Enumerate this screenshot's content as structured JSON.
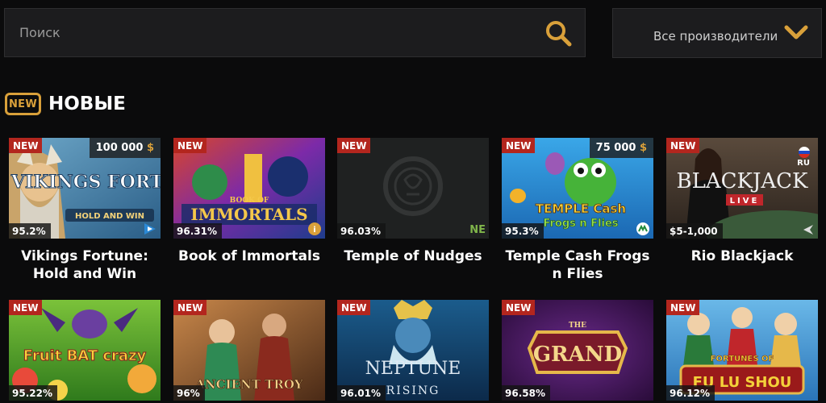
{
  "search": {
    "placeholder": "Поиск"
  },
  "provider_filter": {
    "selected": "Все производители"
  },
  "section": {
    "badge": "NEW",
    "title": "НОВЫЕ"
  },
  "colors": {
    "accent": "#d9a03a",
    "badge_red": "#b3261e",
    "background": "#0b0b0c",
    "panel": "#1c1c1e"
  },
  "games": [
    {
      "title": "Vikings Fortune: Hold and Win",
      "badge": "NEW",
      "rtp": "95.2%",
      "jackpot": "100 000",
      "currency": "$",
      "art_text": "VIKINGS FORTUNE",
      "art_sub": "HOLD AND WIN"
    },
    {
      "title": "Book of Immortals",
      "badge": "NEW",
      "rtp": "96.31%",
      "art_text": "IMMORTALS",
      "art_sub": "BOOK OF"
    },
    {
      "title": "Temple of Nudges",
      "badge": "NEW",
      "rtp": "96.03%",
      "provider_tag": "NE"
    },
    {
      "title": "Temple Cash Frogs n Flies",
      "badge": "NEW",
      "rtp": "95.3%",
      "jackpot": "75 000",
      "currency": "$",
      "art_text": "TEMPLE Cash",
      "art_sub": "Frogs n Flies"
    },
    {
      "title": "Rio Blackjack",
      "badge": "NEW",
      "rtp": "$5-1,000",
      "lang": "RU",
      "art_text": "BLACKJACK",
      "art_sub": "LIVE"
    },
    {
      "title": "",
      "badge": "NEW",
      "rtp": "95.22%",
      "art_text": "Fruit BAT crazy"
    },
    {
      "title": "",
      "badge": "NEW",
      "rtp": "96%",
      "art_text": "ANCIENT TROY"
    },
    {
      "title": "",
      "badge": "NEW",
      "rtp": "96.01%",
      "art_text": "NEPTUNE",
      "art_sub": "RISING"
    },
    {
      "title": "",
      "badge": "NEW",
      "rtp": "96.58%",
      "art_text": "GRAND",
      "art_sub": "THE"
    },
    {
      "title": "",
      "badge": "NEW",
      "rtp": "96.12%",
      "art_text": "FU LU SHOU",
      "art_sub": "FORTUNES OF"
    }
  ]
}
